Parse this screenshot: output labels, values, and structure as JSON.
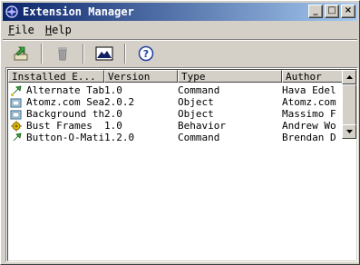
{
  "window": {
    "title": "Extension Manager",
    "controls": {
      "minimize": "_",
      "maximize": "□",
      "close": "×"
    }
  },
  "menu": [
    {
      "label": "File",
      "mnemonic": "F",
      "rest": "ile"
    },
    {
      "label": "Help",
      "mnemonic": "H",
      "rest": "elp"
    }
  ],
  "toolbar": {
    "buttons": [
      {
        "icon": "install-extension-icon"
      },
      {
        "icon": "trash-icon"
      },
      {
        "icon": "mountain-icon"
      },
      {
        "icon": "help-icon",
        "glyph": "?"
      }
    ]
  },
  "list": {
    "columns": [
      "Installed E...",
      "Version",
      "Type",
      "Author"
    ],
    "rows": [
      {
        "icon": "command-icon",
        "name": "Alternate Tab",
        "version": "1.0",
        "type": "Command",
        "author": "Hava Edel"
      },
      {
        "icon": "object-icon",
        "name": "Atomz.com Sea",
        "version": "2.0.2",
        "type": "Object",
        "author": "Atomz.com"
      },
      {
        "icon": "object-icon",
        "name": "Background th",
        "version": "2.0",
        "type": "Object",
        "author": "Massimo F"
      },
      {
        "icon": "behavior-icon",
        "name": "Bust Frames",
        "version": "1.0",
        "type": "Behavior",
        "author": "Andrew Wo"
      },
      {
        "icon": "command-icon",
        "name": "Button-O-Mati",
        "version": "1.2.0",
        "type": "Command",
        "author": "Brendan D"
      }
    ]
  },
  "colors": {
    "titlebar_start": "#0a246a",
    "titlebar_end": "#a6caf0",
    "face": "#d4d0c8"
  }
}
